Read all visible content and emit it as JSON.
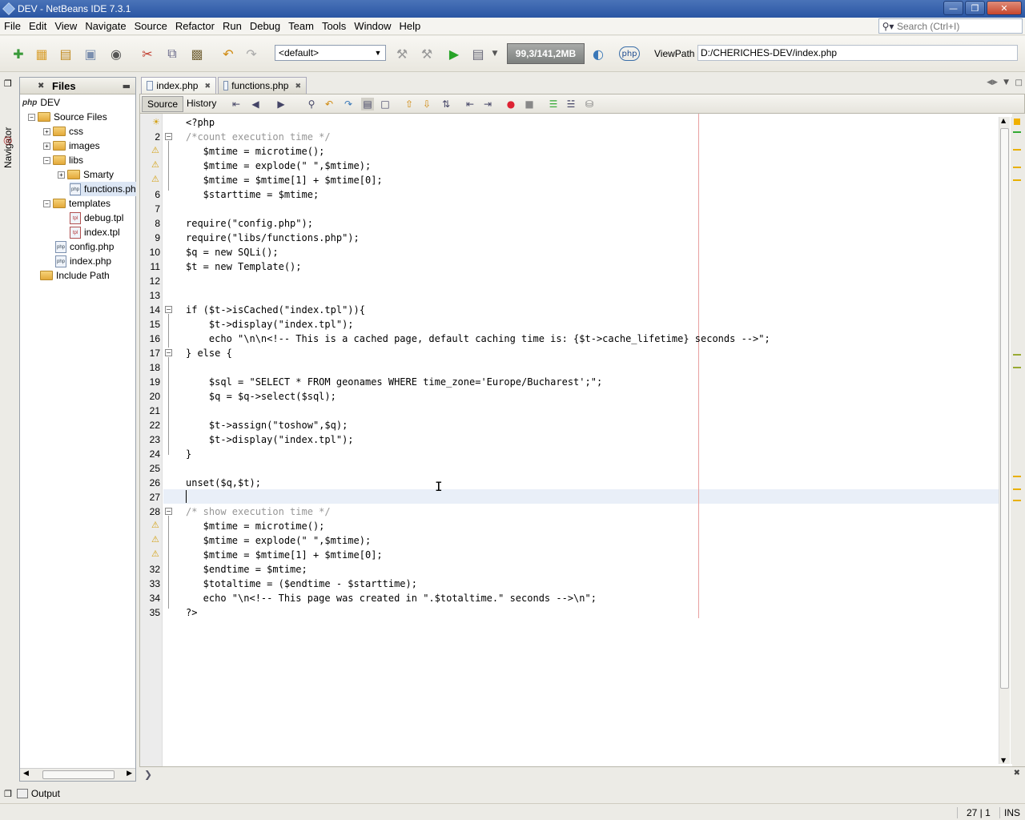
{
  "window": {
    "title": "DEV - NetBeans IDE 7.3.1"
  },
  "menu": [
    "File",
    "Edit",
    "View",
    "Navigate",
    "Source",
    "Refactor",
    "Run",
    "Debug",
    "Team",
    "Tools",
    "Window",
    "Help"
  ],
  "search": {
    "placeholder": "Search (Ctrl+I)"
  },
  "toolbar": {
    "config": "<default>",
    "memory": "99,3/141,2MB",
    "php_badge": "php",
    "viewpath_label": "ViewPath :",
    "viewpath_value": "D:/CHERICHES-DEV/index.php"
  },
  "navigator_label": "Navigator",
  "files": {
    "title": "Files",
    "tree": [
      {
        "label": "DEV",
        "kind": "project"
      },
      {
        "label": "Source Files",
        "kind": "folder"
      },
      {
        "label": "css",
        "kind": "folder"
      },
      {
        "label": "images",
        "kind": "folder"
      },
      {
        "label": "libs",
        "kind": "folder"
      },
      {
        "label": "Smarty",
        "kind": "folder"
      },
      {
        "label": "functions.ph",
        "kind": "file"
      },
      {
        "label": "templates",
        "kind": "folder"
      },
      {
        "label": "debug.tpl",
        "kind": "file"
      },
      {
        "label": "index.tpl",
        "kind": "file"
      },
      {
        "label": "config.php",
        "kind": "file"
      },
      {
        "label": "index.php",
        "kind": "file"
      },
      {
        "label": "Include Path",
        "kind": "folder"
      }
    ]
  },
  "editor": {
    "tabs": [
      "index.php",
      "functions.php"
    ],
    "subtabs": [
      "Source",
      "History"
    ],
    "line_numbers": [
      "2",
      "6",
      "7",
      "8",
      "9",
      "10",
      "11",
      "12",
      "13",
      "14",
      "15",
      "16",
      "17",
      "18",
      "19",
      "20",
      "21",
      "22",
      "23",
      "24",
      "25",
      "26",
      "27",
      "28",
      "32",
      "33",
      "34",
      "35"
    ],
    "code": [
      "<?php",
      "/*count execution time */",
      "   $mtime = microtime();",
      "   $mtime = explode(\" \",$mtime);",
      "   $mtime = $mtime[1] + $mtime[0];",
      "   $starttime = $mtime;",
      "",
      "require(\"config.php\");",
      "require(\"libs/functions.php\");",
      "$q = new SQLi();",
      "$t = new Template();",
      "",
      "",
      "if ($t->isCached(\"index.tpl\")){",
      "    $t->display(\"index.tpl\");",
      "    echo \"\\n\\n<!-- This is a cached page, default caching time is: {$t->cache_lifetime} seconds -->\";",
      "} else {",
      "",
      "    $sql = \"SELECT * FROM geonames WHERE time_zone='Europe/Bucharest';\";",
      "    $q = $q->select($sql);",
      "",
      "    $t->assign(\"toshow\",$q);",
      "    $t->display(\"index.tpl\");",
      "}",
      "",
      "unset($q,$t);",
      "",
      "/* show execution time */",
      "   $mtime = microtime();",
      "   $mtime = explode(\" \",$mtime);",
      "   $mtime = $mtime[1] + $mtime[0];",
      "   $endtime = $mtime;",
      "   $totaltime = ($endtime - $starttime);",
      "   echo \"\\n<!-- This page was created in \".$totaltime.\" seconds -->\\n\";",
      "?>"
    ]
  },
  "output_label": "Output",
  "status": {
    "position": "27 | 1",
    "mode": "INS"
  }
}
